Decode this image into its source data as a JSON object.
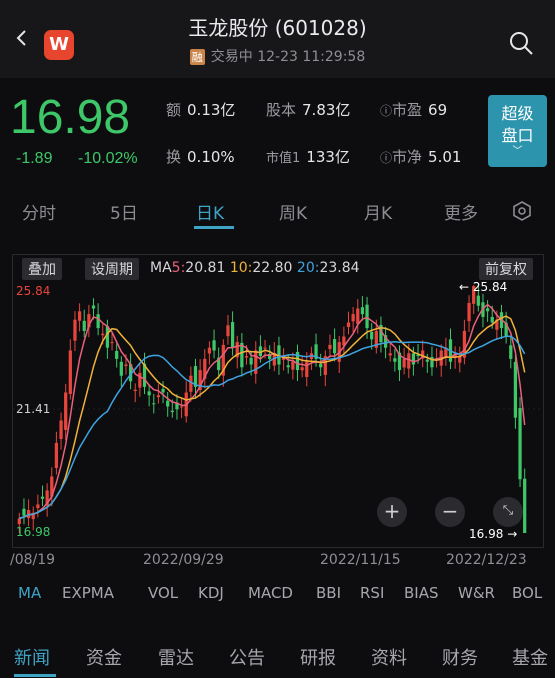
{
  "header": {
    "title": "玉龙股份 (601028)",
    "badge": "融",
    "status": "交易中 12-23 11:29:58",
    "logo_letter": "W"
  },
  "quote": {
    "price": "16.98",
    "change": "-1.89",
    "change_pct": "-10.02%",
    "stats": {
      "amount_label": "额",
      "amount_value": "0.13亿",
      "capital_label": "股本",
      "capital_value": "7.83亿",
      "pe_label": "市盈",
      "pe_value": "69",
      "turnover_label": "换",
      "turnover_value": "0.10%",
      "mcap_label": "市值1",
      "mcap_value": "133亿",
      "pb_label": "市净",
      "pb_value": "5.01"
    },
    "super_button": [
      "超级",
      "盘口"
    ]
  },
  "tabs": [
    "分时",
    "5日",
    "日K",
    "周K",
    "月K",
    "更多"
  ],
  "chart": {
    "overlay_btn": "叠加",
    "period_btn": "设周期",
    "adjust_btn": "前复权",
    "ma_prefix": "MA",
    "ma5_label": "5:",
    "ma5": "20.81",
    "ma10_label": "10:",
    "ma10": "22.80",
    "ma20_label": "20:",
    "ma20": "23.84",
    "price_high": "25.84",
    "price_mid": "21.41",
    "price_low": "16.98",
    "marker_high": "25.84",
    "marker_low": "16.98",
    "zoom_in": "+",
    "zoom_out": "−",
    "dates": [
      "/08/19",
      "2022/09/29",
      "2022/11/15",
      "2022/12/23"
    ],
    "colors": {
      "up": "#e8453d",
      "down": "#3ec769",
      "ma5": "#e9617c",
      "ma10": "#f0b23a",
      "ma20": "#3fa3e0"
    }
  },
  "indicators": [
    "MA",
    "EXPMA",
    "VOL",
    "KDJ",
    "MACD",
    "BBI",
    "RSI",
    "BIAS",
    "W&R",
    "BOL"
  ],
  "bottom_tabs": [
    "新闻",
    "资金",
    "雷达",
    "公告",
    "研报",
    "资料",
    "财务",
    "基金"
  ]
}
